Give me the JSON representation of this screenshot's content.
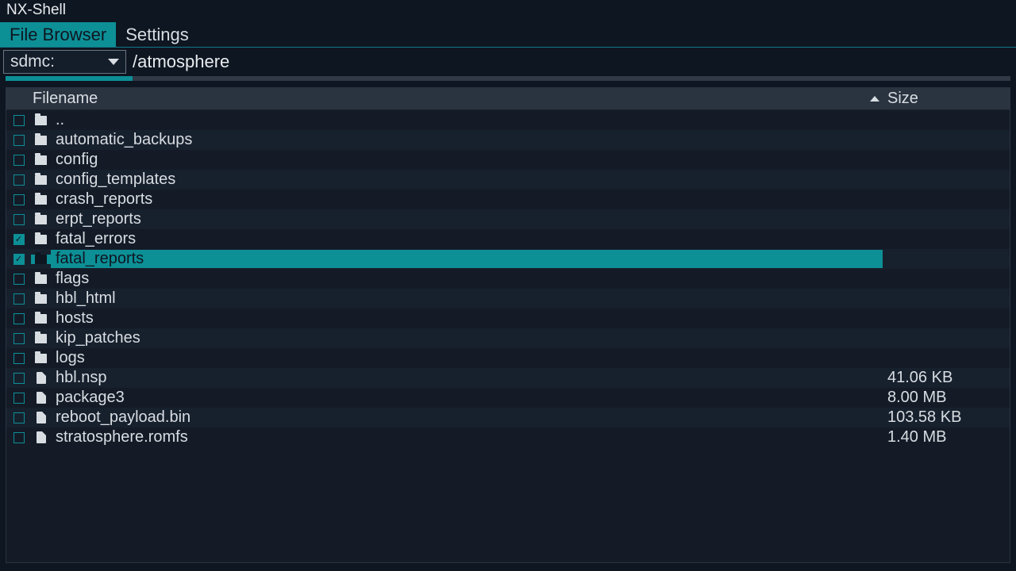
{
  "app": {
    "title": "NX-Shell"
  },
  "tabs": [
    {
      "label": "File Browser",
      "active": true
    },
    {
      "label": "Settings",
      "active": false
    }
  ],
  "path": {
    "drive": "sdmc:",
    "path": "/atmosphere"
  },
  "table": {
    "columns": {
      "filename": "Filename",
      "size": "Size"
    },
    "sortColumn": "size",
    "sortAsc": true
  },
  "rows": [
    {
      "name": "..",
      "type": "folder",
      "checked": false,
      "selected": false,
      "size": ""
    },
    {
      "name": "automatic_backups",
      "type": "folder",
      "checked": false,
      "selected": false,
      "size": ""
    },
    {
      "name": "config",
      "type": "folder",
      "checked": false,
      "selected": false,
      "size": ""
    },
    {
      "name": "config_templates",
      "type": "folder",
      "checked": false,
      "selected": false,
      "size": ""
    },
    {
      "name": "crash_reports",
      "type": "folder",
      "checked": false,
      "selected": false,
      "size": ""
    },
    {
      "name": "erpt_reports",
      "type": "folder",
      "checked": false,
      "selected": false,
      "size": ""
    },
    {
      "name": "fatal_errors",
      "type": "folder",
      "checked": true,
      "selected": false,
      "size": ""
    },
    {
      "name": "fatal_reports",
      "type": "folder",
      "checked": true,
      "selected": true,
      "size": ""
    },
    {
      "name": "flags",
      "type": "folder",
      "checked": false,
      "selected": false,
      "size": ""
    },
    {
      "name": "hbl_html",
      "type": "folder",
      "checked": false,
      "selected": false,
      "size": ""
    },
    {
      "name": "hosts",
      "type": "folder",
      "checked": false,
      "selected": false,
      "size": ""
    },
    {
      "name": "kip_patches",
      "type": "folder",
      "checked": false,
      "selected": false,
      "size": ""
    },
    {
      "name": "logs",
      "type": "folder",
      "checked": false,
      "selected": false,
      "size": ""
    },
    {
      "name": "hbl.nsp",
      "type": "file",
      "checked": false,
      "selected": false,
      "size": "41.06 KB"
    },
    {
      "name": "package3",
      "type": "file",
      "checked": false,
      "selected": false,
      "size": "8.00 MB"
    },
    {
      "name": "reboot_payload.bin",
      "type": "file",
      "checked": false,
      "selected": false,
      "size": "103.58 KB"
    },
    {
      "name": "stratosphere.romfs",
      "type": "file",
      "checked": false,
      "selected": false,
      "size": "1.40 MB"
    }
  ]
}
